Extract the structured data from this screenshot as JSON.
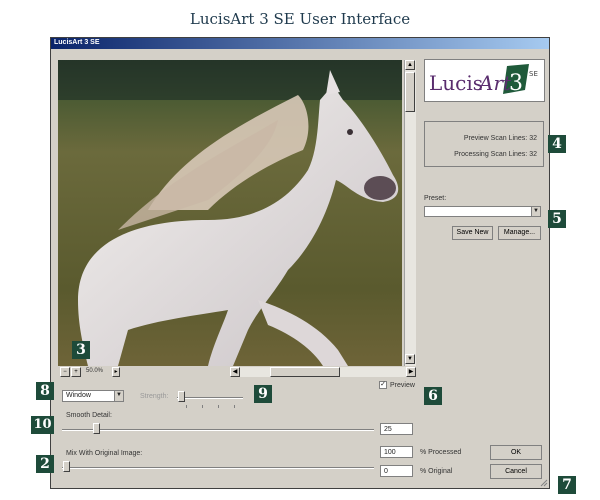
{
  "heading": "LucisArt 3 SE User Interface",
  "window": {
    "title": "LucisArt 3 SE"
  },
  "logo": {
    "text_lucis": "Lucis",
    "text_art": "Art",
    "number": "3",
    "sup": "SE"
  },
  "scan": {
    "preview_label": "Preview Scan Lines:",
    "preview_value": "32",
    "processing_label": "Processing Scan Lines:",
    "processing_value": "32"
  },
  "preset": {
    "label": "Preset:",
    "value": "",
    "save_new": "Save New",
    "manage": "Manage..."
  },
  "zoom": {
    "minus": "−",
    "plus": "+",
    "value": "50.0%"
  },
  "preview_checkbox": {
    "label": "Preview",
    "checked": "✓"
  },
  "mode": {
    "value": "Window"
  },
  "strength": {
    "label": "Strength:"
  },
  "smooth_detail": {
    "label": "Smooth Detail:",
    "value": "25"
  },
  "mix": {
    "label": "Mix With Original Image:",
    "processed_value": "100",
    "processed_label": "% Processed",
    "original_value": "0",
    "original_label": "% Original"
  },
  "buttons": {
    "ok": "OK",
    "cancel": "Cancel"
  },
  "badges": {
    "b2": "2",
    "b3": "3",
    "b4": "4",
    "b5": "5",
    "b6": "6",
    "b7": "7",
    "b8": "8",
    "b9": "9",
    "b10": "10"
  },
  "colors": {
    "window_bg": "#d4d0c8",
    "badge_bg": "#1e4b3a",
    "titlebar": "#0a246a",
    "logo_purple": "#5a2d6e",
    "logo_green": "#1f5a3a"
  }
}
